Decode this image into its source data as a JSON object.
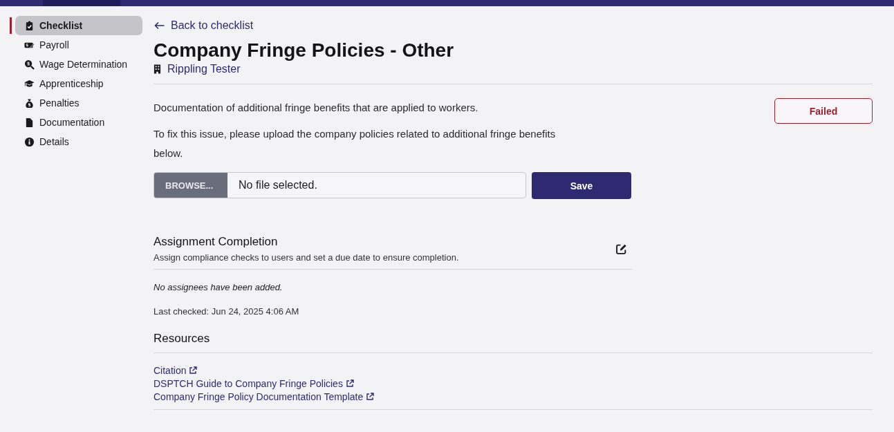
{
  "sidebar": {
    "items": [
      {
        "label": "Checklist",
        "selected": true
      },
      {
        "label": "Payroll",
        "selected": false
      },
      {
        "label": "Wage Determination",
        "selected": false
      },
      {
        "label": "Apprenticeship",
        "selected": false
      },
      {
        "label": "Penalties",
        "selected": false
      },
      {
        "label": "Documentation",
        "selected": false
      },
      {
        "label": "Details",
        "selected": false
      }
    ]
  },
  "back_link": "Back to checklist",
  "title": "Company Fringe Policies - Other",
  "company": "Rippling Tester",
  "description": "Documentation of additional fringe benefits that are applied to workers.",
  "instructions": "To fix this issue, please upload the company policies related to additional fringe benefits below.",
  "status": {
    "label": "Failed",
    "kind": "failed"
  },
  "upload": {
    "browse_label": "BROWSE...",
    "value": "No file selected.",
    "save_label": "Save"
  },
  "assignment": {
    "title": "Assignment Completion",
    "subtitle": "Assign compliance checks to users and set a due date to ensure completion.",
    "empty": "No assignees have been added."
  },
  "last_checked": "Last checked: Jun 24, 2025 4:06 AM",
  "resources": {
    "title": "Resources",
    "links": [
      "Citation",
      "DSPTCH Guide to Company Fringe Policies",
      "Company Fringe Policy Documentation Template"
    ]
  }
}
